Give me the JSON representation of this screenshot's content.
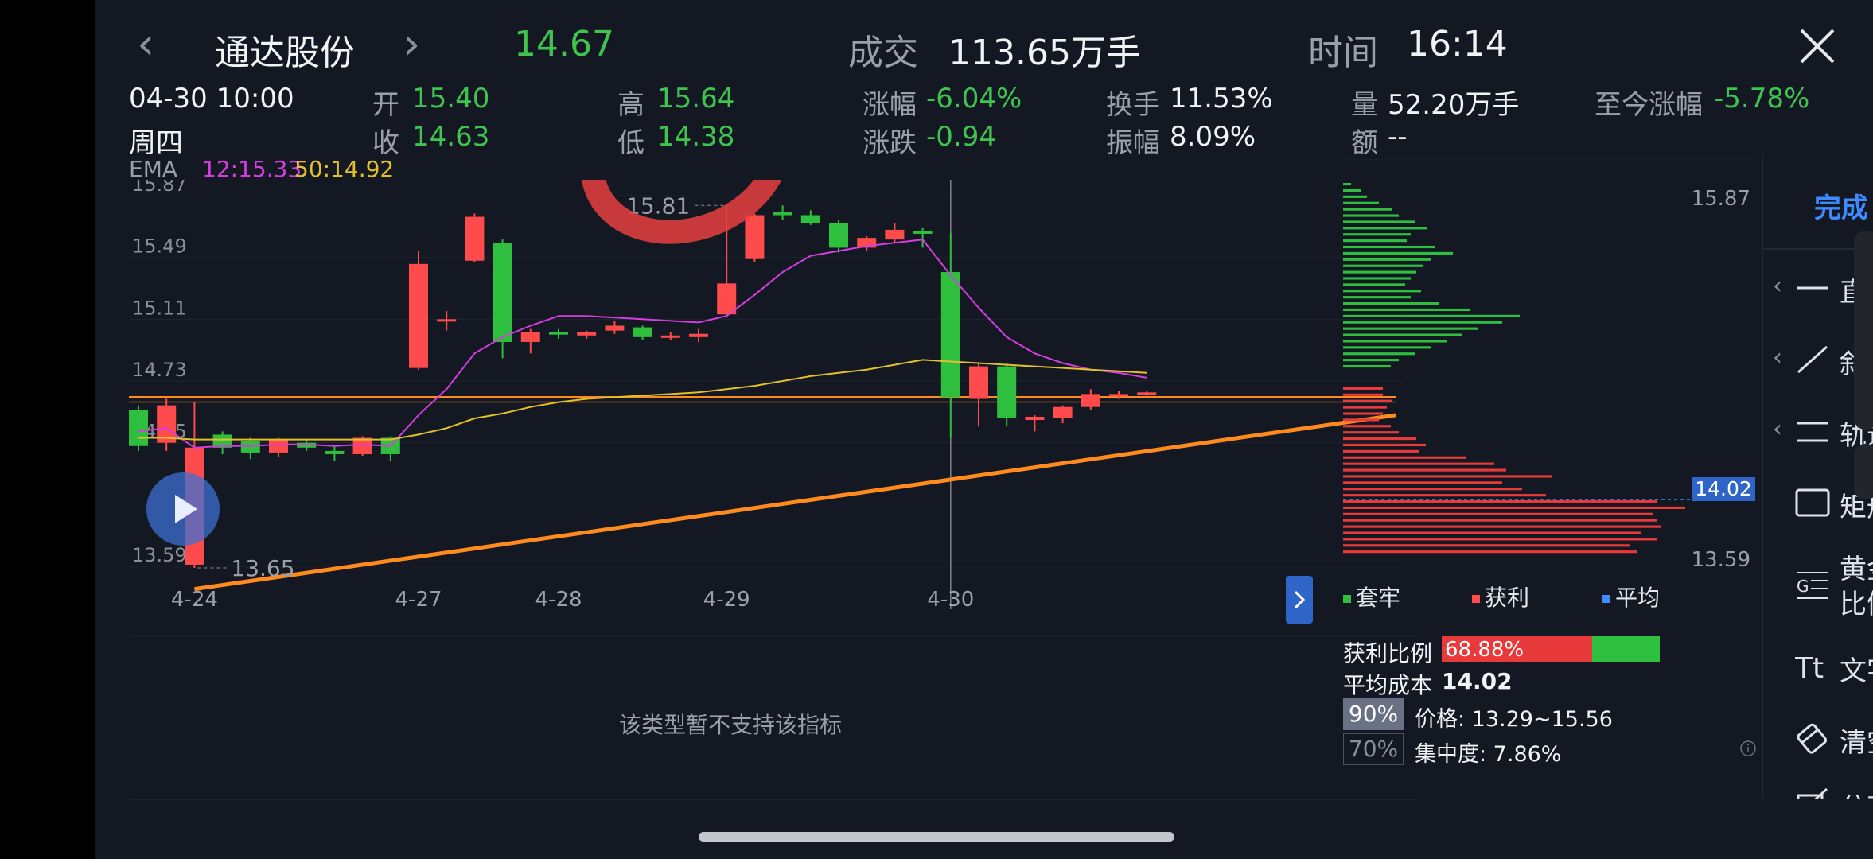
{
  "header": {
    "stock_name": "通达股份",
    "price": "14.67",
    "volume_label": "成交",
    "volume_value": "113.65万手",
    "time_label": "时间",
    "time_value": "16:14"
  },
  "info": {
    "datetime": "04-30 10:00",
    "weekday": "周四",
    "open_label": "开",
    "open_value": "15.40",
    "close_label": "收",
    "close_value": "14.63",
    "high_label": "高",
    "high_value": "15.64",
    "low_label": "低",
    "low_value": "14.38",
    "change_pct_label": "涨幅",
    "change_pct_value": "-6.04%",
    "change_label": "涨跌",
    "change_value": "-0.94",
    "turnover_label": "换手",
    "turnover_value": "11.53%",
    "amplitude_label": "振幅",
    "amplitude_value": "8.09%",
    "qty_label": "量",
    "qty_value": "52.20万手",
    "amount_label": "额",
    "amount_value": "--",
    "ytd_label": "至今涨幅",
    "ytd_value": "-5.78%"
  },
  "ema": {
    "label": "EMA",
    "ema12": "12:15.33",
    "ema50": "50:14.92",
    "color12": "#d63ce0",
    "color50": "#e3c12a"
  },
  "colors": {
    "up": "#ff4b4b",
    "down": "#2fbf3f",
    "trendline": "#ff8a1e",
    "background": "#141822"
  },
  "chart_data": {
    "type": "candlestick",
    "ylim": [
      13.59,
      15.87
    ],
    "y_ticks": [
      "15.87",
      "15.49",
      "15.11",
      "14.73",
      "14.35",
      "13.59"
    ],
    "x_ticks": [
      "4-24",
      "4-27",
      "4-28",
      "4-29",
      "4-30"
    ],
    "max_annotation": "15.81",
    "min_annotation": "13.65",
    "candles": [
      {
        "o": 14.55,
        "c": 14.33,
        "h": 14.58,
        "l": 14.3
      },
      {
        "o": 14.35,
        "c": 14.58,
        "h": 14.62,
        "l": 14.3
      },
      {
        "o": 13.6,
        "c": 14.32,
        "h": 14.6,
        "l": 13.58
      },
      {
        "o": 14.4,
        "c": 14.32,
        "h": 14.42,
        "l": 14.28
      },
      {
        "o": 14.36,
        "c": 14.29,
        "h": 14.38,
        "l": 14.25
      },
      {
        "o": 14.29,
        "c": 14.37,
        "h": 14.38,
        "l": 14.26
      },
      {
        "o": 14.35,
        "c": 14.32,
        "h": 14.37,
        "l": 14.3
      },
      {
        "o": 14.3,
        "c": 14.28,
        "h": 14.33,
        "l": 14.24
      },
      {
        "o": 14.28,
        "c": 14.38,
        "h": 14.39,
        "l": 14.27
      },
      {
        "o": 14.38,
        "c": 14.28,
        "h": 14.39,
        "l": 14.24
      },
      {
        "o": 14.81,
        "c": 15.45,
        "h": 15.53,
        "l": 14.8
      },
      {
        "o": 15.11,
        "c": 15.11,
        "h": 15.16,
        "l": 15.04
      },
      {
        "o": 15.47,
        "c": 15.74,
        "h": 15.76,
        "l": 15.46
      },
      {
        "o": 15.58,
        "c": 14.97,
        "h": 15.6,
        "l": 14.87
      },
      {
        "o": 14.97,
        "c": 15.03,
        "h": 15.05,
        "l": 14.9
      },
      {
        "o": 15.03,
        "c": 15.02,
        "h": 15.05,
        "l": 14.99
      },
      {
        "o": 15.01,
        "c": 15.03,
        "h": 15.04,
        "l": 14.99
      },
      {
        "o": 15.04,
        "c": 15.07,
        "h": 15.1,
        "l": 15.02
      },
      {
        "o": 15.06,
        "c": 15.0,
        "h": 15.07,
        "l": 14.98
      },
      {
        "o": 15.0,
        "c": 15.01,
        "h": 15.03,
        "l": 14.98
      },
      {
        "o": 15.0,
        "c": 15.02,
        "h": 15.05,
        "l": 14.97
      },
      {
        "o": 15.14,
        "c": 15.33,
        "h": 15.81,
        "l": 15.12
      },
      {
        "o": 15.48,
        "c": 15.75,
        "h": 15.76,
        "l": 15.46
      },
      {
        "o": 15.77,
        "c": 15.75,
        "h": 15.81,
        "l": 15.72
      },
      {
        "o": 15.75,
        "c": 15.7,
        "h": 15.78,
        "l": 15.69
      },
      {
        "o": 15.7,
        "c": 15.55,
        "h": 15.72,
        "l": 15.52
      },
      {
        "o": 15.55,
        "c": 15.61,
        "h": 15.62,
        "l": 15.53
      },
      {
        "o": 15.6,
        "c": 15.66,
        "h": 15.7,
        "l": 15.58
      },
      {
        "o": 15.65,
        "c": 15.64,
        "h": 15.67,
        "l": 15.55
      },
      {
        "o": 15.4,
        "c": 14.63,
        "h": 15.64,
        "l": 14.38
      },
      {
        "o": 14.62,
        "c": 14.82,
        "h": 14.84,
        "l": 14.45
      },
      {
        "o": 14.82,
        "c": 14.5,
        "h": 14.84,
        "l": 14.45
      },
      {
        "o": 14.49,
        "c": 14.51,
        "h": 14.52,
        "l": 14.42
      },
      {
        "o": 14.5,
        "c": 14.57,
        "h": 14.58,
        "l": 14.47
      },
      {
        "o": 14.57,
        "c": 14.65,
        "h": 14.68,
        "l": 14.55
      },
      {
        "o": 14.64,
        "c": 14.65,
        "h": 14.67,
        "l": 14.62
      },
      {
        "o": 14.65,
        "c": 14.66,
        "h": 14.67,
        "l": 14.63
      }
    ],
    "ema12": [
      14.42,
      14.44,
      14.32,
      14.33,
      14.33,
      14.34,
      14.34,
      14.33,
      14.34,
      14.33,
      14.52,
      14.68,
      14.9,
      15.0,
      15.07,
      15.13,
      15.13,
      15.12,
      15.11,
      15.1,
      15.09,
      15.13,
      15.26,
      15.4,
      15.5,
      15.53,
      15.56,
      15.58,
      15.6,
      15.38,
      15.18,
      15.0,
      14.9,
      14.84,
      14.8,
      14.78,
      14.75
    ],
    "ema50": [
      14.38,
      14.38,
      14.37,
      14.37,
      14.37,
      14.37,
      14.37,
      14.37,
      14.37,
      14.37,
      14.4,
      14.44,
      14.5,
      14.53,
      14.57,
      14.6,
      14.62,
      14.63,
      14.64,
      14.65,
      14.66,
      14.68,
      14.7,
      14.73,
      14.76,
      14.78,
      14.8,
      14.83,
      14.86,
      14.85,
      14.84,
      14.83,
      14.82,
      14.81,
      14.8,
      14.79,
      14.78
    ],
    "hline": 14.63,
    "trendline": {
      "x0": 2,
      "y0": 13.45,
      "x1": 38,
      "y1": 14.52
    }
  },
  "chip": {
    "top_price": "15.87",
    "bottom_price": "13.59",
    "avg_price_tag": "14.02",
    "legend": [
      "套牢",
      "获利",
      "平均"
    ],
    "profit_ratio_label": "获利比例",
    "profit_ratio_value": "68.88%",
    "profit_ratio": 0.6888,
    "avg_cost_label": "平均成本",
    "avg_cost_value": "14.02",
    "pct90": "90%",
    "pct70": "70%",
    "price_range_text": "价格: 13.29~15.56",
    "concentration_text": "集中度: 7.86%",
    "green_bars": [
      10,
      22,
      30,
      45,
      62,
      70,
      90,
      105,
      85,
      80,
      115,
      138,
      110,
      100,
      92,
      85,
      78,
      98,
      85,
      120,
      160,
      222,
      200,
      170,
      150,
      130,
      110,
      90,
      70,
      60
    ],
    "red_bars": [
      50,
      50,
      62,
      55,
      50,
      45,
      60,
      70,
      92,
      104,
      95,
      155,
      190,
      205,
      262,
      200,
      225,
      255,
      395,
      430,
      390,
      395,
      400,
      375,
      395,
      360,
      370
    ],
    "legend_colors": [
      "#2fbf3f",
      "#ff4b4b",
      "#3d8bff"
    ]
  },
  "indicator_notice": "该类型暂不支持该指标",
  "toolbar": {
    "done_label": "完成",
    "tools": [
      {
        "label": "直线",
        "icon": "straight-line-icon"
      },
      {
        "label": "斜线",
        "icon": "diagonal-line-icon"
      },
      {
        "label": "轨道",
        "icon": "channel-icon"
      },
      {
        "label": "矩形",
        "icon": "rectangle-icon"
      },
      {
        "label": "黄金比例",
        "label_lines": [
          "黄金",
          "比例"
        ],
        "icon": "golden-ratio-icon"
      },
      {
        "label": "文字",
        "icon": "text-icon"
      },
      {
        "label": "清空",
        "icon": "eraser-icon"
      },
      {
        "label": "分享",
        "icon": "share-icon"
      }
    ]
  }
}
